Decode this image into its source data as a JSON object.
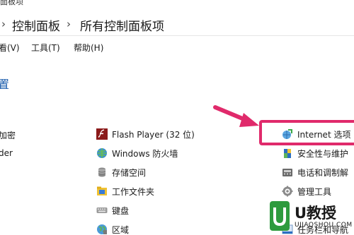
{
  "window": {
    "title": "面板项"
  },
  "address": {
    "crumbs": [
      "控制面板",
      "所有控制面板项"
    ]
  },
  "menu": {
    "items": [
      "看(V)",
      "工具(T)",
      "帮助(H)"
    ]
  },
  "section": {
    "title": "置"
  },
  "left_partial": {
    "row1": "加密",
    "row2": "der"
  },
  "items_col2": [
    {
      "label": "Flash Player (32 位)",
      "icon": "flash-icon"
    },
    {
      "label": "Windows 防火墙",
      "icon": "firewall-icon"
    },
    {
      "label": "存储空间",
      "icon": "storage-icon"
    },
    {
      "label": "工作文件夹",
      "icon": "work-folders-icon"
    },
    {
      "label": "键盘",
      "icon": "keyboard-icon"
    },
    {
      "label": "区域",
      "icon": "region-icon"
    }
  ],
  "items_col3": [
    {
      "label": "Internet 选项",
      "icon": "internet-options-icon"
    },
    {
      "label": "安全性与维护",
      "icon": "security-maintenance-icon"
    },
    {
      "label": "电话和调制解",
      "icon": "phone-modem-icon"
    },
    {
      "label": "管理工具",
      "icon": "admin-tools-icon"
    },
    {
      "label": "任务栏和导航",
      "icon": "taskbar-icon"
    }
  ],
  "colors": {
    "highlight": "#e02a6b",
    "link": "#1e5fae",
    "brand_green": "#2e9b3e"
  },
  "watermark": {
    "title": "U教授",
    "url": "UJIAOSHOU.COM"
  }
}
